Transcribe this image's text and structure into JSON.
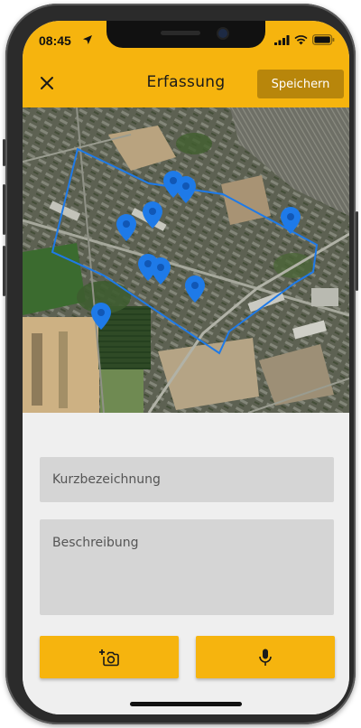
{
  "status_bar": {
    "time": "08:45",
    "icons": [
      "location-arrow-icon",
      "signal-icon",
      "wifi-icon",
      "battery-icon"
    ]
  },
  "app_bar": {
    "title": "Erfassung",
    "close_icon": "close-icon",
    "save_label": "Speichern"
  },
  "map": {
    "type": "satellite",
    "area_outline_color": "#1e7ae8",
    "marker_color": "#1e7ae8",
    "marker_count": 9
  },
  "form": {
    "short_label_placeholder": "Kurzbezeichnung",
    "description_placeholder": "Beschreibung"
  },
  "actions": {
    "camera_icon": "add-photo-icon",
    "mic_icon": "microphone-icon"
  },
  "colors": {
    "accent": "#f6b40e",
    "save_button": "#b8860b",
    "field_bg": "#d5d5d5"
  }
}
